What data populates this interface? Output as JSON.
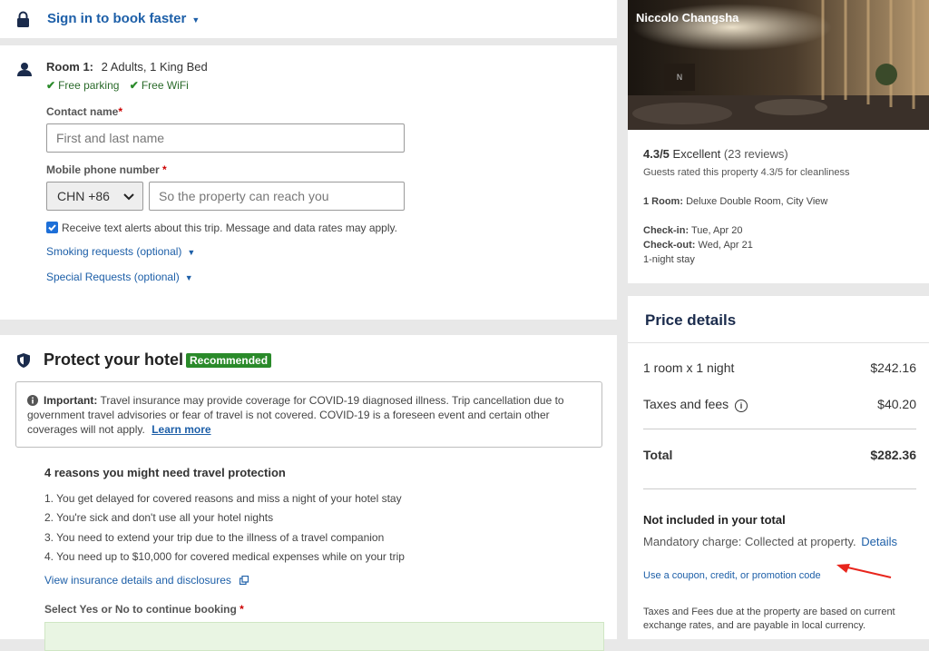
{
  "signin": {
    "label": "Sign in to book faster"
  },
  "room": {
    "label": "Room 1:",
    "detail": "2 Adults, 1 King Bed",
    "amenities": [
      "Free parking",
      "Free WiFi"
    ],
    "contact_label": "Contact name",
    "contact_placeholder": "First and last name",
    "phone_label": "Mobile phone number",
    "country_code": "CHN +86",
    "phone_placeholder": "So the property can reach you",
    "sms_text": "Receive text alerts about this trip. Message and data rates may apply.",
    "smoking_link": "Smoking requests (optional)",
    "special_link": "Special Requests (optional)"
  },
  "protect": {
    "title": "Protect your hotel",
    "badge": "Recommended",
    "important_label": "Important:",
    "important_text": "Travel insurance may provide coverage for COVID-19 diagnosed illness. Trip cancellation due to government travel advisories or fear of travel is not covered. COVID-19 is a foreseen event and certain other coverages will not apply.",
    "learn_more": "Learn more",
    "reasons_title": "4 reasons you might need travel protection",
    "reasons": [
      "1. You get delayed for covered reasons and miss a night of your hotel stay",
      "2. You're sick and don't use all your hotel nights",
      "3. You need to extend your trip due to the illness of a travel companion",
      "4. You need up to $10,000 for covered medical expenses while on your trip"
    ],
    "details_link": "View insurance details and disclosures",
    "select_label": "Select Yes or No to continue booking"
  },
  "hotel": {
    "name": "Niccolo Changsha",
    "rating": "4.3/5",
    "rating_word": "Excellent",
    "reviews": "(23 reviews)",
    "cleanliness": "Guests rated this property 4.3/5 for cleanliness",
    "room_label": "1 Room:",
    "room_type": "Deluxe Double Room, City View",
    "checkin_label": "Check-in:",
    "checkin": "Tue, Apr 20",
    "checkout_label": "Check-out:",
    "checkout": "Wed, Apr 21",
    "stay": "1-night stay"
  },
  "price": {
    "title": "Price details",
    "rows": [
      {
        "label": "1 room x 1 night",
        "amount": "$242.16"
      },
      {
        "label": "Taxes and fees",
        "amount": "$40.20"
      }
    ],
    "total_label": "Total",
    "total_amount": "$282.36",
    "not_included_title": "Not included in your total",
    "mandatory_text": "Mandatory charge: Collected at property.",
    "details_link": "Details",
    "coupon_link": "Use a coupon, credit, or promotion code",
    "footnote": "Taxes and Fees due at the property are based on current exchange rates, and are payable in local currency."
  },
  "colors": {
    "link": "#1d5fa8",
    "badge_bg": "#2a8a2a",
    "check": "#2a8a2a",
    "arrow": "#e8251c"
  }
}
